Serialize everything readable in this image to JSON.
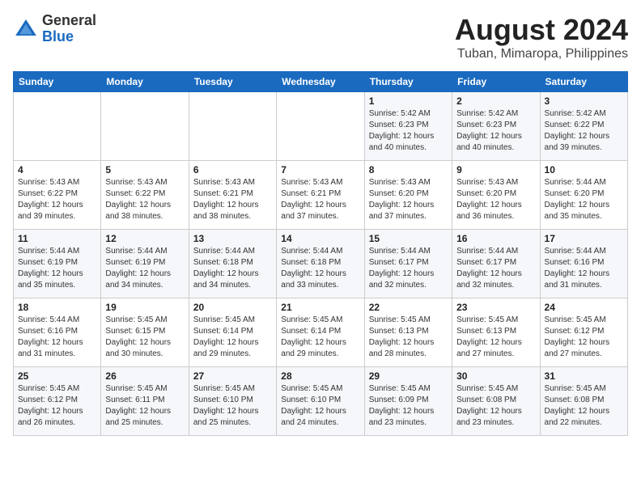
{
  "logo": {
    "general": "General",
    "blue": "Blue"
  },
  "title": "August 2024",
  "subtitle": "Tuban, Mimaropa, Philippines",
  "days_of_week": [
    "Sunday",
    "Monday",
    "Tuesday",
    "Wednesday",
    "Thursday",
    "Friday",
    "Saturday"
  ],
  "weeks": [
    [
      {
        "day": "",
        "info": ""
      },
      {
        "day": "",
        "info": ""
      },
      {
        "day": "",
        "info": ""
      },
      {
        "day": "",
        "info": ""
      },
      {
        "day": "1",
        "info": "Sunrise: 5:42 AM\nSunset: 6:23 PM\nDaylight: 12 hours\nand 40 minutes."
      },
      {
        "day": "2",
        "info": "Sunrise: 5:42 AM\nSunset: 6:23 PM\nDaylight: 12 hours\nand 40 minutes."
      },
      {
        "day": "3",
        "info": "Sunrise: 5:42 AM\nSunset: 6:22 PM\nDaylight: 12 hours\nand 39 minutes."
      }
    ],
    [
      {
        "day": "4",
        "info": "Sunrise: 5:43 AM\nSunset: 6:22 PM\nDaylight: 12 hours\nand 39 minutes."
      },
      {
        "day": "5",
        "info": "Sunrise: 5:43 AM\nSunset: 6:22 PM\nDaylight: 12 hours\nand 38 minutes."
      },
      {
        "day": "6",
        "info": "Sunrise: 5:43 AM\nSunset: 6:21 PM\nDaylight: 12 hours\nand 38 minutes."
      },
      {
        "day": "7",
        "info": "Sunrise: 5:43 AM\nSunset: 6:21 PM\nDaylight: 12 hours\nand 37 minutes."
      },
      {
        "day": "8",
        "info": "Sunrise: 5:43 AM\nSunset: 6:20 PM\nDaylight: 12 hours\nand 37 minutes."
      },
      {
        "day": "9",
        "info": "Sunrise: 5:43 AM\nSunset: 6:20 PM\nDaylight: 12 hours\nand 36 minutes."
      },
      {
        "day": "10",
        "info": "Sunrise: 5:44 AM\nSunset: 6:20 PM\nDaylight: 12 hours\nand 35 minutes."
      }
    ],
    [
      {
        "day": "11",
        "info": "Sunrise: 5:44 AM\nSunset: 6:19 PM\nDaylight: 12 hours\nand 35 minutes."
      },
      {
        "day": "12",
        "info": "Sunrise: 5:44 AM\nSunset: 6:19 PM\nDaylight: 12 hours\nand 34 minutes."
      },
      {
        "day": "13",
        "info": "Sunrise: 5:44 AM\nSunset: 6:18 PM\nDaylight: 12 hours\nand 34 minutes."
      },
      {
        "day": "14",
        "info": "Sunrise: 5:44 AM\nSunset: 6:18 PM\nDaylight: 12 hours\nand 33 minutes."
      },
      {
        "day": "15",
        "info": "Sunrise: 5:44 AM\nSunset: 6:17 PM\nDaylight: 12 hours\nand 32 minutes."
      },
      {
        "day": "16",
        "info": "Sunrise: 5:44 AM\nSunset: 6:17 PM\nDaylight: 12 hours\nand 32 minutes."
      },
      {
        "day": "17",
        "info": "Sunrise: 5:44 AM\nSunset: 6:16 PM\nDaylight: 12 hours\nand 31 minutes."
      }
    ],
    [
      {
        "day": "18",
        "info": "Sunrise: 5:44 AM\nSunset: 6:16 PM\nDaylight: 12 hours\nand 31 minutes."
      },
      {
        "day": "19",
        "info": "Sunrise: 5:45 AM\nSunset: 6:15 PM\nDaylight: 12 hours\nand 30 minutes."
      },
      {
        "day": "20",
        "info": "Sunrise: 5:45 AM\nSunset: 6:14 PM\nDaylight: 12 hours\nand 29 minutes."
      },
      {
        "day": "21",
        "info": "Sunrise: 5:45 AM\nSunset: 6:14 PM\nDaylight: 12 hours\nand 29 minutes."
      },
      {
        "day": "22",
        "info": "Sunrise: 5:45 AM\nSunset: 6:13 PM\nDaylight: 12 hours\nand 28 minutes."
      },
      {
        "day": "23",
        "info": "Sunrise: 5:45 AM\nSunset: 6:13 PM\nDaylight: 12 hours\nand 27 minutes."
      },
      {
        "day": "24",
        "info": "Sunrise: 5:45 AM\nSunset: 6:12 PM\nDaylight: 12 hours\nand 27 minutes."
      }
    ],
    [
      {
        "day": "25",
        "info": "Sunrise: 5:45 AM\nSunset: 6:12 PM\nDaylight: 12 hours\nand 26 minutes."
      },
      {
        "day": "26",
        "info": "Sunrise: 5:45 AM\nSunset: 6:11 PM\nDaylight: 12 hours\nand 25 minutes."
      },
      {
        "day": "27",
        "info": "Sunrise: 5:45 AM\nSunset: 6:10 PM\nDaylight: 12 hours\nand 25 minutes."
      },
      {
        "day": "28",
        "info": "Sunrise: 5:45 AM\nSunset: 6:10 PM\nDaylight: 12 hours\nand 24 minutes."
      },
      {
        "day": "29",
        "info": "Sunrise: 5:45 AM\nSunset: 6:09 PM\nDaylight: 12 hours\nand 23 minutes."
      },
      {
        "day": "30",
        "info": "Sunrise: 5:45 AM\nSunset: 6:08 PM\nDaylight: 12 hours\nand 23 minutes."
      },
      {
        "day": "31",
        "info": "Sunrise: 5:45 AM\nSunset: 6:08 PM\nDaylight: 12 hours\nand 22 minutes."
      }
    ]
  ]
}
